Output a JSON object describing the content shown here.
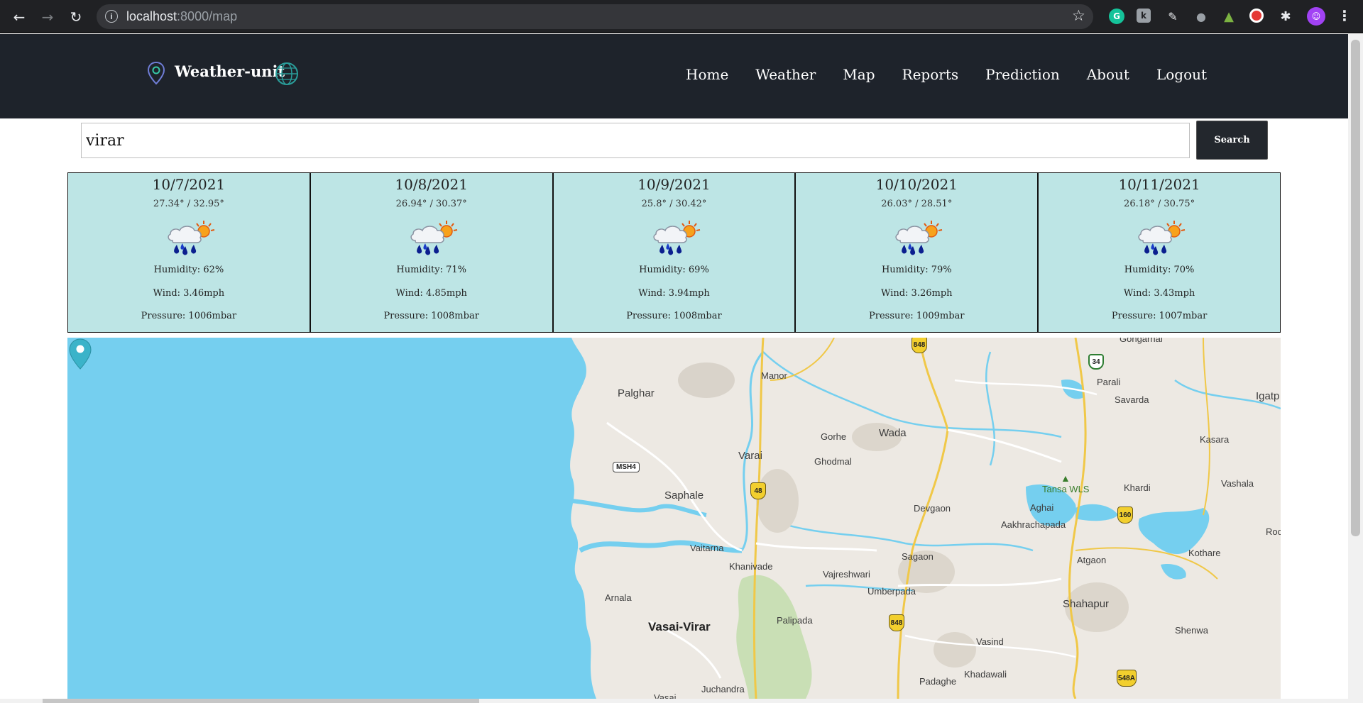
{
  "browser": {
    "url_host": "localhost",
    "url_path": ":8000/map"
  },
  "header": {
    "brand": "Weather-unit",
    "nav": [
      "Home",
      "Weather",
      "Map",
      "Reports",
      "Prediction",
      "About",
      "Logout"
    ]
  },
  "search": {
    "value": "virar",
    "button_label": "Search"
  },
  "forecast": [
    {
      "date": "10/7/2021",
      "temp": "27.34° / 32.95°",
      "humidity": "Humidity: 62%",
      "wind": "Wind: 3.46mph",
      "pressure": "Pressure: 1006mbar"
    },
    {
      "date": "10/8/2021",
      "temp": "26.94° / 30.37°",
      "humidity": "Humidity: 71%",
      "wind": "Wind: 4.85mph",
      "pressure": "Pressure: 1008mbar"
    },
    {
      "date": "10/9/2021",
      "temp": "25.8° / 30.42°",
      "humidity": "Humidity: 69%",
      "wind": "Wind: 3.94mph",
      "pressure": "Pressure: 1008mbar"
    },
    {
      "date": "10/10/2021",
      "temp": "26.03° / 28.51°",
      "humidity": "Humidity: 79%",
      "wind": "Wind: 3.26mph",
      "pressure": "Pressure: 1009mbar"
    },
    {
      "date": "10/11/2021",
      "temp": "26.18° / 30.75°",
      "humidity": "Humidity: 70%",
      "wind": "Wind: 3.43mph",
      "pressure": "Pressure: 1007mbar"
    }
  ],
  "map": {
    "labels": {
      "palghar": "Palghar",
      "manor": "Manor",
      "parali": "Parali",
      "savarda": "Savarda",
      "igatpuri": "Igatp",
      "gorhe": "Gorhe",
      "wada": "Wada",
      "varai": "Varai",
      "ghodmal": "Ghodmal",
      "kasara": "Kasara",
      "tansa": "Tansa WLS",
      "khardi": "Khardi",
      "vashala": "Vashala",
      "saphale": "Saphale",
      "devgaon": "Devgaon",
      "aghai": "Aghai",
      "aakhrachapada": "Aakhrachapada",
      "roc": "Roc",
      "vaitarna": "Vaitarna",
      "sagaon": "Sagaon",
      "kothare": "Kothare",
      "khanivade": "Khanivade",
      "atgaon": "Atgaon",
      "vajreshwari": "Vajreshwari",
      "arnala": "Arnala",
      "umberpada": "Umberpada",
      "shahapur": "Shahapur",
      "vasai_virar": "Vasai-Virar",
      "palipada": "Palipada",
      "shenwa": "Shenwa",
      "vasind": "Vasind",
      "khadawali": "Khadawali",
      "padaghe": "Padaghe",
      "juchandra": "Juchandra",
      "vasai": "Vasai",
      "gongarhal": "Gongarhal"
    },
    "shields": {
      "nh848_top": "848",
      "nh34": "34",
      "nh48": "48",
      "nh160": "160",
      "nh848_mid": "848",
      "nh548a": "548A",
      "msh4": "MSH4"
    }
  }
}
